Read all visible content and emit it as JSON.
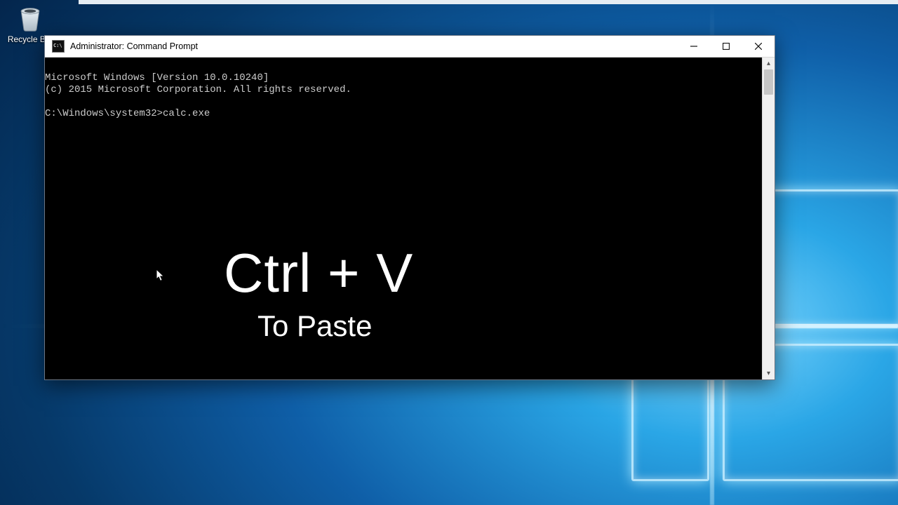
{
  "desktop": {
    "icons": {
      "recycle_bin_label": "Recycle Bin"
    }
  },
  "window": {
    "title": "Administrator: Command Prompt",
    "terminal": {
      "line1": "Microsoft Windows [Version 10.0.10240]",
      "line2": "(c) 2015 Microsoft Corporation. All rights reserved.",
      "blank": "",
      "prompt": "C:\\Windows\\system32>",
      "command": "calc.exe"
    }
  },
  "overlay": {
    "shortcut": "Ctrl + V",
    "caption": "To Paste"
  }
}
